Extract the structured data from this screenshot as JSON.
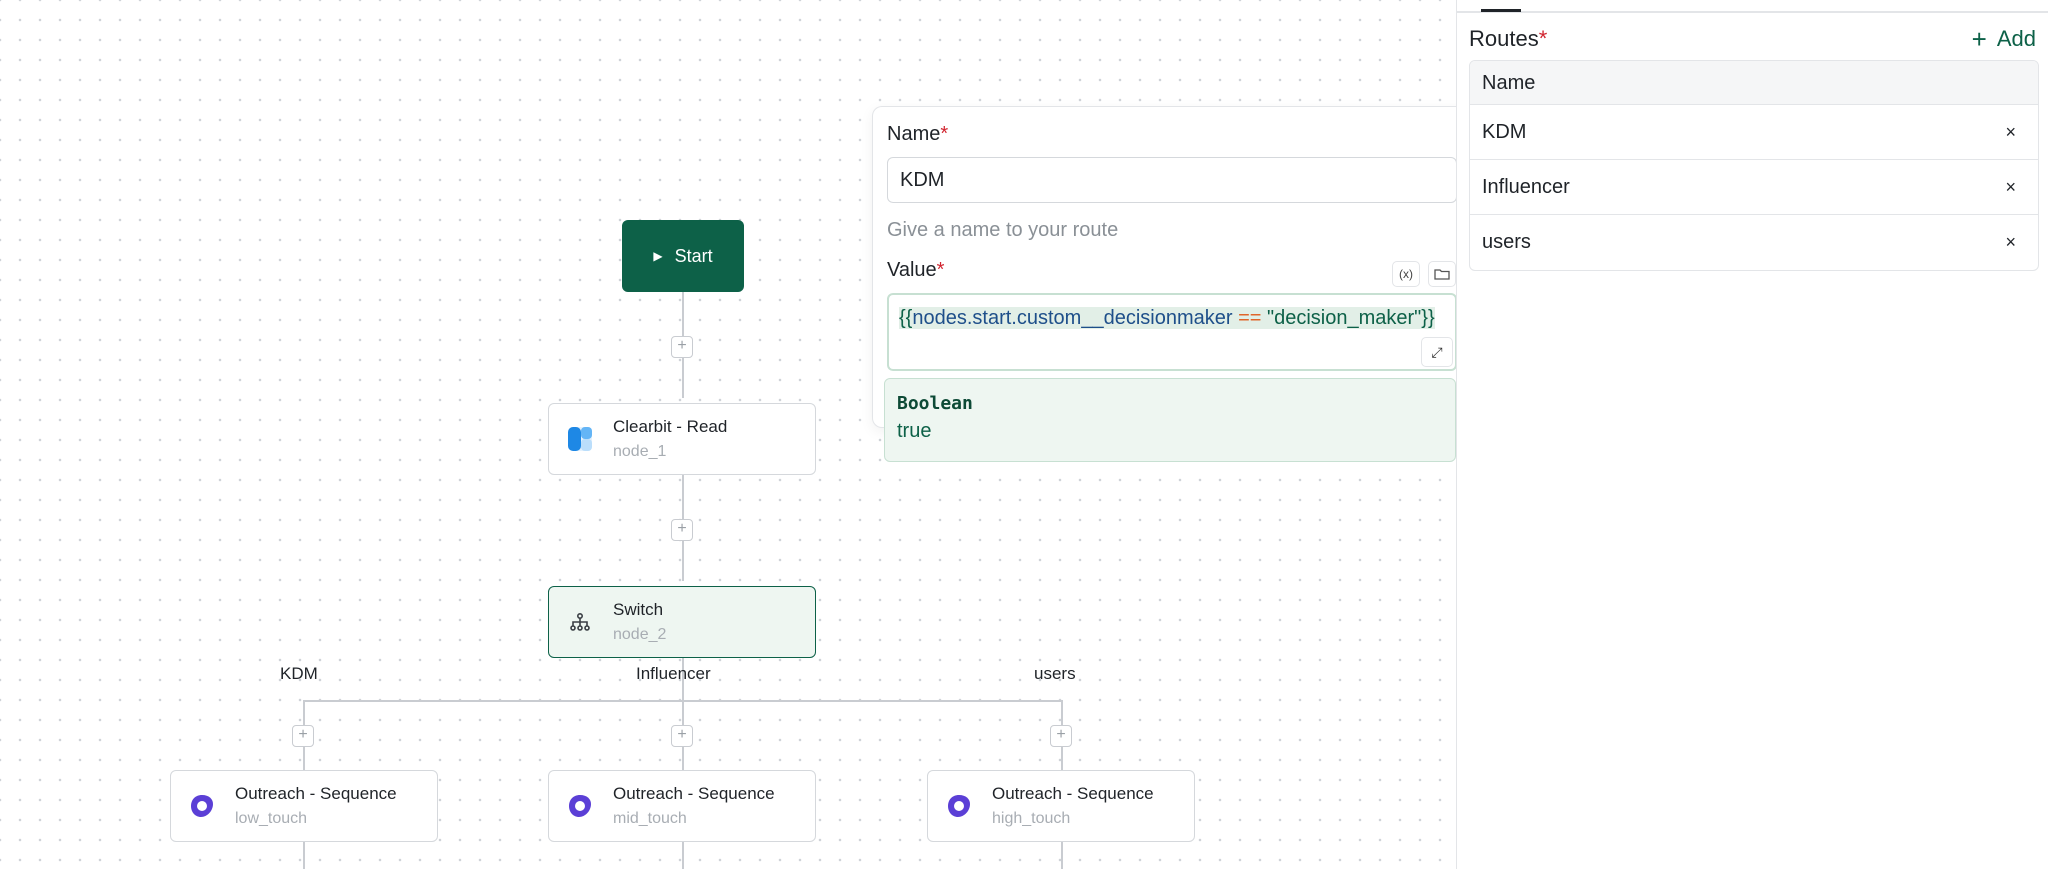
{
  "canvas": {
    "start_label": "Start",
    "nodes": [
      {
        "title": "Clearbit - Read",
        "id": "node_1"
      },
      {
        "title": "Switch",
        "id": "node_2"
      },
      {
        "title": "Outreach - Sequence",
        "id": "low_touch"
      },
      {
        "title": "Outreach - Sequence",
        "id": "mid_touch"
      },
      {
        "title": "Outreach - Sequence",
        "id": "high_touch"
      }
    ],
    "route_labels": [
      "KDM",
      "Influencer",
      "users"
    ],
    "plus_symbol": "+"
  },
  "editor": {
    "name_label": "Name",
    "name_value": "KDM",
    "name_helper": "Give a name to your route",
    "value_label": "Value",
    "variable_tool": "(x)",
    "code": {
      "open": "{{",
      "path": "nodes.start.custom__decisionmaker",
      "op": "==",
      "str": "\"decision_maker\"",
      "close": "}}"
    },
    "result_type": "Boolean",
    "result_value": "true",
    "required_mark": "*"
  },
  "panel": {
    "routes_title": "Routes",
    "add_label": "Add",
    "table_header": "Name",
    "routes": [
      "KDM",
      "Influencer",
      "users"
    ],
    "remove_symbol": "×"
  },
  "colors": {
    "brand": "#0d6148",
    "outreach": "#5b3fd6",
    "clearbit": "#1e88e5"
  }
}
